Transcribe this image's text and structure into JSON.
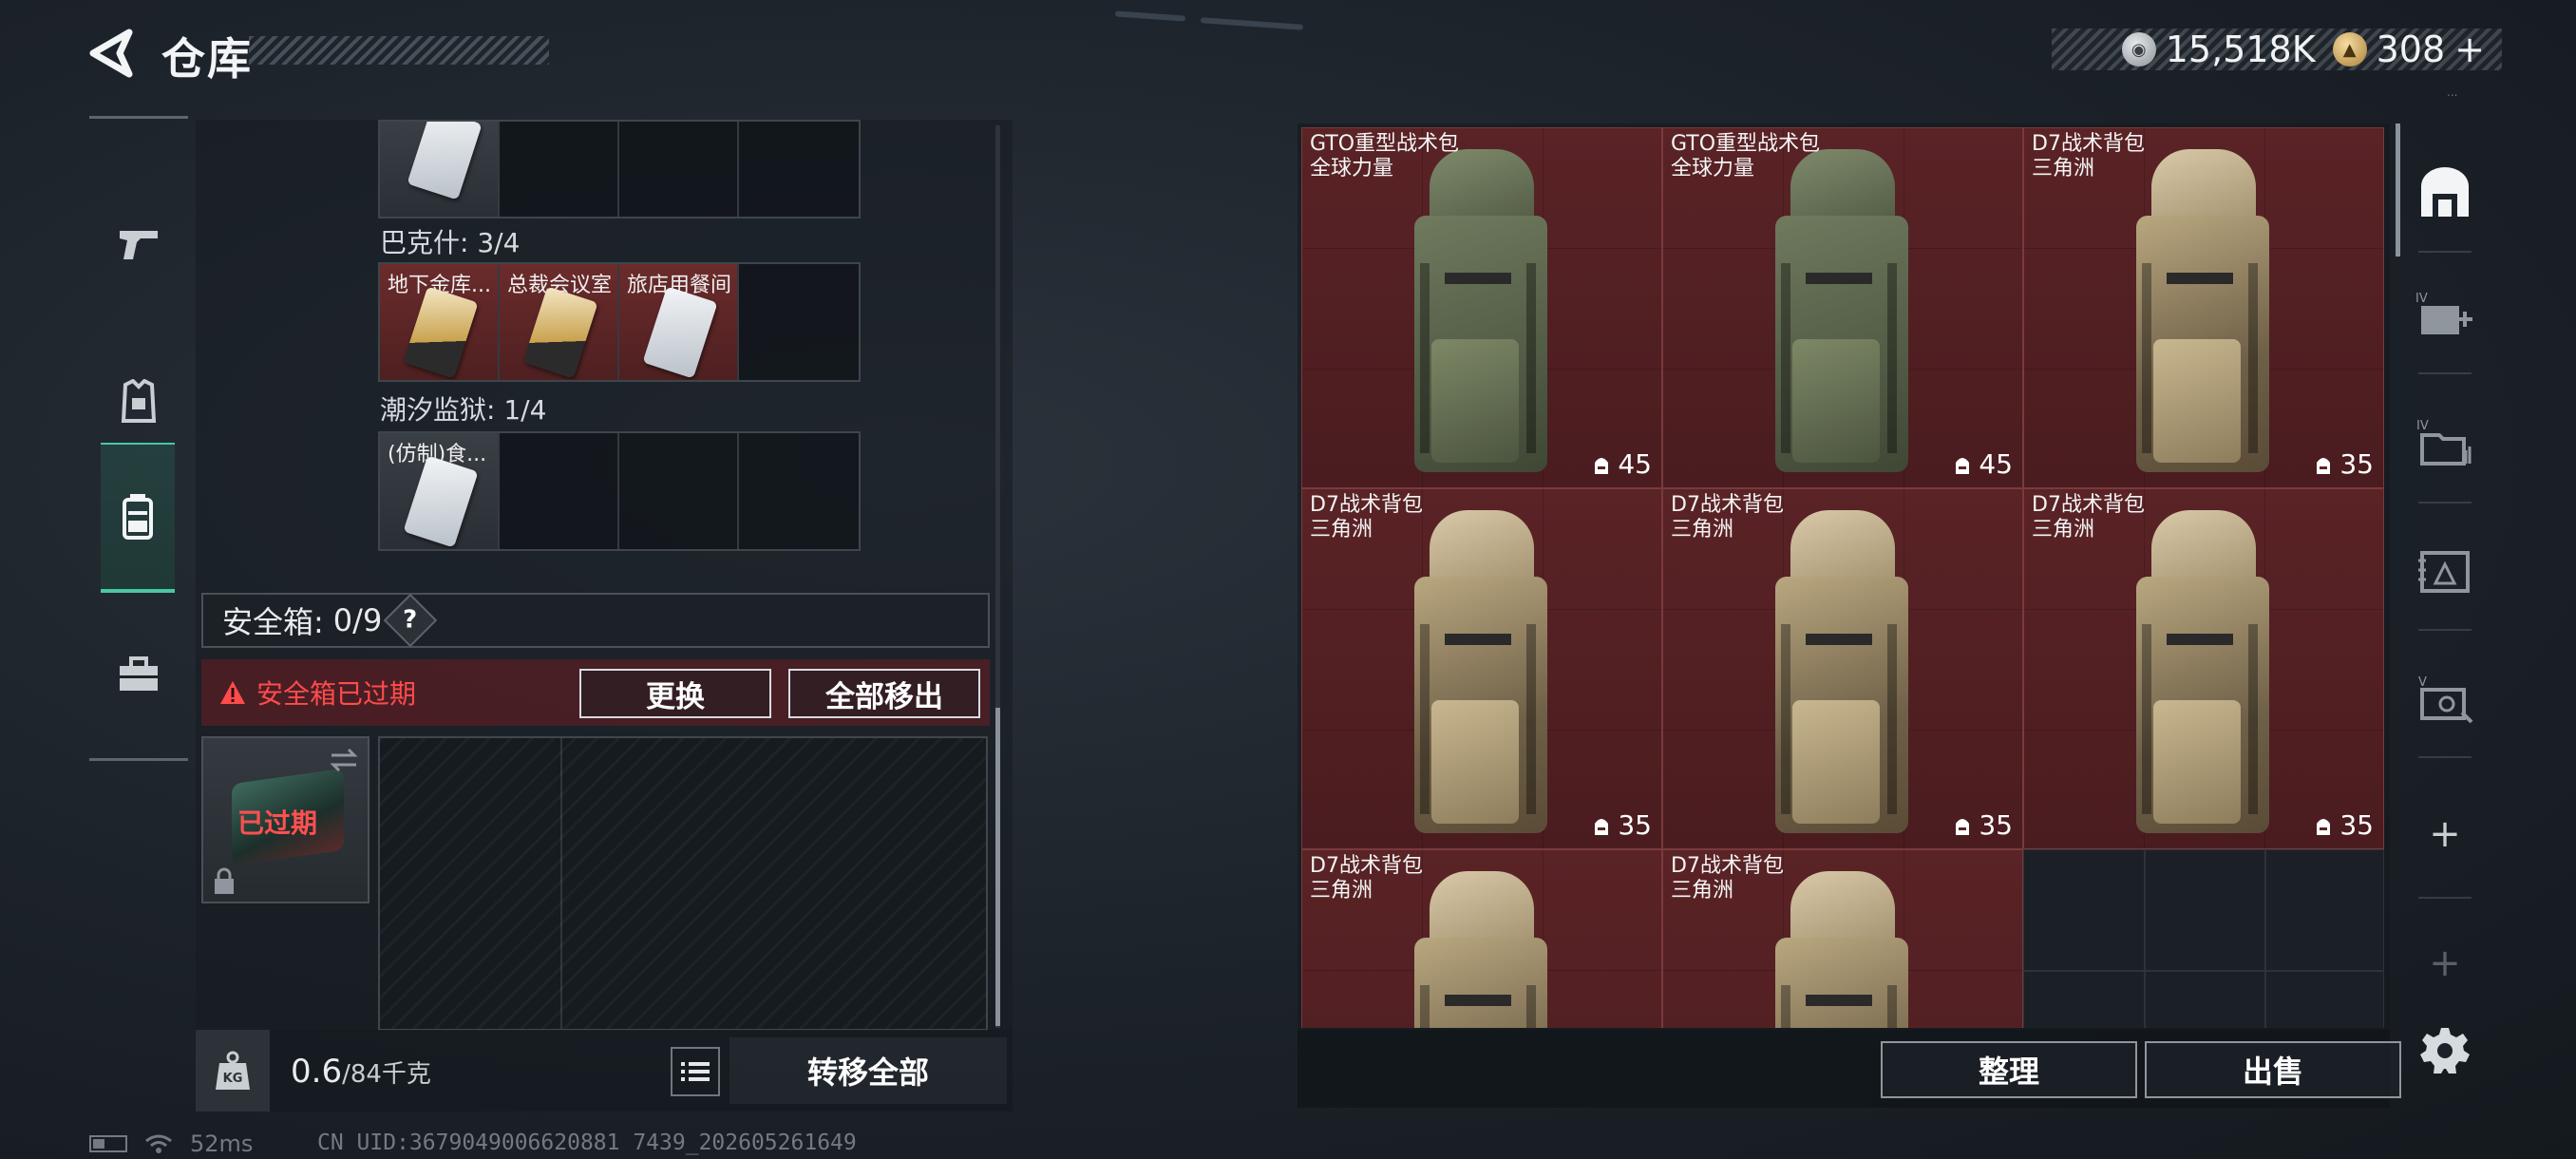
{
  "header": {
    "title": "仓库",
    "currency": [
      {
        "icon": "silver-coin-icon",
        "value": "15,518K"
      },
      {
        "icon": "gold-coin-icon",
        "value": "308",
        "add_symbol": "+"
      }
    ],
    "version_tag": "..."
  },
  "left_tabs": [
    {
      "icon": "pistol-icon",
      "active": false
    },
    {
      "icon": "armor-vest-icon",
      "active": false
    },
    {
      "icon": "backpack-icon",
      "active": true
    },
    {
      "icon": "toolbox-icon",
      "active": false
    }
  ],
  "key_sections": [
    {
      "label": "",
      "slots": [
        {
          "label": "",
          "card": "white"
        },
        {
          "empty": true
        },
        {
          "empty": true
        },
        {
          "empty": true
        }
      ]
    },
    {
      "label": "巴克什: 3/4",
      "slots": [
        {
          "label": "地下金库...",
          "card": "gold"
        },
        {
          "label": "总裁会议室",
          "card": "gold"
        },
        {
          "label": "旅店用餐间",
          "card": "white"
        },
        {
          "empty": true
        }
      ]
    },
    {
      "label": "潮汐监狱: 1/4",
      "slots": [
        {
          "label": "(仿制)食...",
          "card": "white"
        },
        {
          "empty": true
        },
        {
          "empty": true
        },
        {
          "empty": true
        }
      ]
    }
  ],
  "safebox": {
    "label": "安全箱:",
    "count": "0/9",
    "help": "?",
    "expired_warning": "安全箱已过期",
    "replace_button": "更换",
    "move_all_button": "全部移出",
    "case_status": "已过期"
  },
  "weight": {
    "current": "0.6",
    "max": "/84千克",
    "transfer_all_button": "转移全部"
  },
  "storage_items": [
    {
      "name": "GTO重型战术包",
      "subtitle": "全球力量",
      "value": "45",
      "style": "green"
    },
    {
      "name": "GTO重型战术包",
      "subtitle": "全球力量",
      "value": "45",
      "style": "green"
    },
    {
      "name": "D7战术背包",
      "subtitle": "三角洲",
      "value": "35",
      "style": "tan"
    },
    {
      "name": "D7战术背包",
      "subtitle": "三角洲",
      "value": "35",
      "style": "tan"
    },
    {
      "name": "D7战术背包",
      "subtitle": "三角洲",
      "value": "35",
      "style": "tan"
    },
    {
      "name": "D7战术背包",
      "subtitle": "三角洲",
      "value": "35",
      "style": "tan"
    },
    {
      "name": "D7战术背包",
      "subtitle": "三角洲",
      "value": "",
      "style": "tan"
    },
    {
      "name": "D7战术背包",
      "subtitle": "三角洲",
      "value": "",
      "style": "tan"
    }
  ],
  "storage_footer": {
    "sort_button": "整理",
    "sell_button": "出售"
  },
  "side_tools": [
    {
      "icon": "storage-home-icon"
    },
    {
      "icon": "expand-storage-icon",
      "tier": "IV"
    },
    {
      "icon": "folder-icon",
      "tier": "IV"
    },
    {
      "icon": "map-icon"
    },
    {
      "icon": "ticket-icon",
      "tier": "V"
    },
    {
      "icon": "add-icon"
    },
    {
      "icon": "add-disabled-icon"
    },
    {
      "icon": "settings-icon"
    }
  ],
  "status_bar": {
    "ping": "52ms",
    "uid": "CN UID:3679049006620881 7439_202605261649"
  },
  "colors": {
    "accent_teal": "#49c7a4",
    "item_bg_red": "#5a2326",
    "warning_red": "#ff4b4b"
  }
}
